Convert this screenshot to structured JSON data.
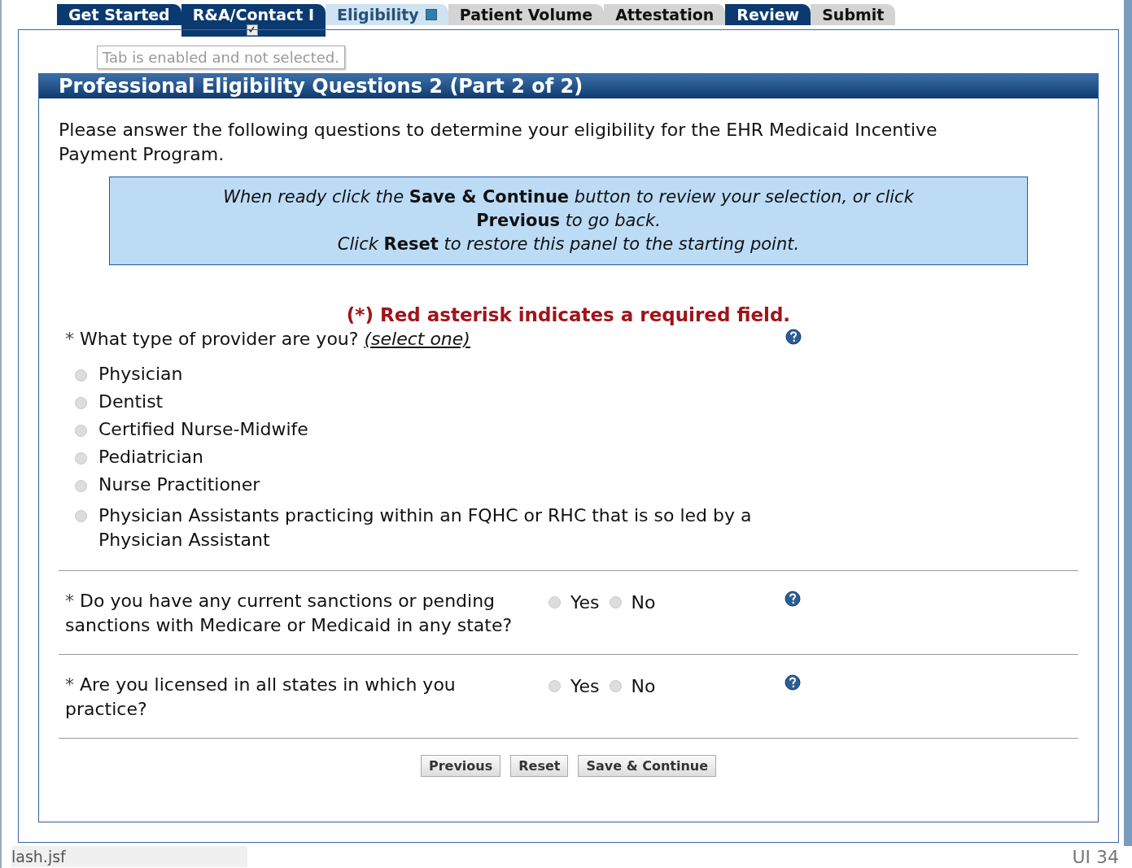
{
  "tabs": [
    {
      "label": "Get Started",
      "kind": "completed"
    },
    {
      "label": "R&A/Contact I",
      "kind": "completed",
      "checked": true
    },
    {
      "label": "Eligibility",
      "kind": "current"
    },
    {
      "label": "Patient Volume",
      "kind": "locked"
    },
    {
      "label": "Attestation",
      "kind": "locked"
    },
    {
      "label": "Review",
      "kind": "completed"
    },
    {
      "label": "Submit",
      "kind": "locked"
    }
  ],
  "tooltip": "Tab is enabled and not selected.",
  "panel": {
    "title": "Professional Eligibility Questions 2 (Part 2 of 2)",
    "intro": "Please answer the following questions to determine your eligibility for the EHR Medicaid Incentive Payment Program.",
    "notice": [
      "*When ready click the* **Save & Continue** *button to review your selection, or click*",
      "**Previous** *to go back.*",
      "*Click* **Reset** *to restore this panel to the starting point.*"
    ],
    "required_note": "(*) Red asterisk indicates a required field.",
    "questions": [
      {
        "kind": "list",
        "asterisk": "*",
        "text": "What type of provider are you?",
        "hint": "(select one)",
        "options": [
          {
            "label": "Physician",
            "selected": false
          },
          {
            "label": "Dentist",
            "selected": false
          },
          {
            "label": "Certified Nurse-Midwife",
            "selected": false
          },
          {
            "label": "Pediatrician",
            "selected": false
          },
          {
            "label": "Nurse Practitioner",
            "selected": false
          },
          {
            "label": "Physician Assistants practicing within an FQHC or RHC that is so led by a Physician Assistant",
            "selected": false
          }
        ]
      },
      {
        "kind": "inline",
        "asterisk": "*",
        "text": "Do you have any current sanctions or pending sanctions with Medicare or Medicaid in any state?",
        "options": [
          {
            "label": "Yes",
            "selected": false
          },
          {
            "label": "No",
            "selected": false
          }
        ]
      },
      {
        "kind": "inline",
        "asterisk": "*",
        "text": "Are you licensed in all states in which you practice?",
        "options": [
          {
            "label": "Yes",
            "selected": false
          },
          {
            "label": "No",
            "selected": false
          }
        ]
      }
    ],
    "buttons": [
      "Previous",
      "Reset",
      "Save & Continue"
    ]
  },
  "status_bar": {
    "url": "lash.jsf",
    "page_label": "UI 34"
  }
}
